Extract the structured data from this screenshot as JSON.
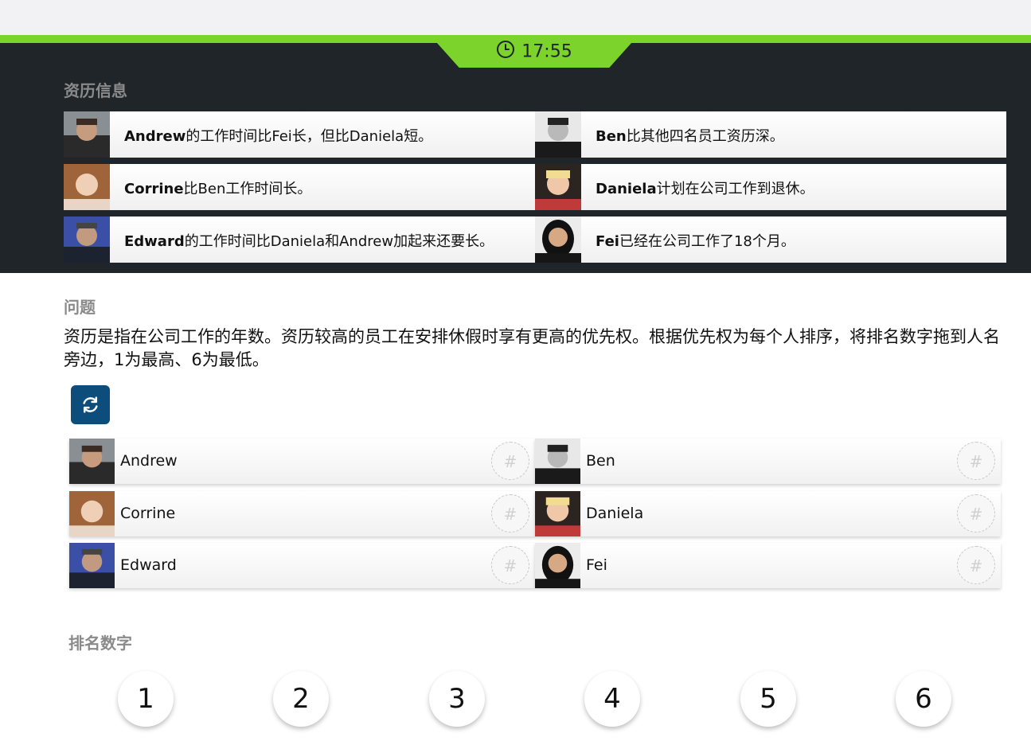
{
  "timer": {
    "time": "17:55"
  },
  "seniority": {
    "title": "资历信息",
    "facts": [
      {
        "name": "Andrew",
        "text": "的工作时间比Fei长，但比Daniela短。"
      },
      {
        "name": "Ben",
        "text": "比其他四名员工资历深。"
      },
      {
        "name": "Corrine",
        "text": "比Ben工作时间长。"
      },
      {
        "name": "Daniela",
        "text": "计划在公司工作到退休。"
      },
      {
        "name": "Edward",
        "text": "的工作时间比Daniela和Andrew加起来还要长。"
      },
      {
        "name": "Fei",
        "text": "已经在公司工作了18个月。"
      }
    ]
  },
  "question": {
    "title": "问题",
    "text": "资历是指在公司工作的年数。资历较高的员工在安排休假时享有更高的优先权。根据优先权为每个人排序，将排名数字拖到人名旁边，1为最高、6为最低。"
  },
  "people": [
    {
      "name": "Andrew",
      "slot": "#"
    },
    {
      "name": "Ben",
      "slot": "#"
    },
    {
      "name": "Corrine",
      "slot": "#"
    },
    {
      "name": "Daniela",
      "slot": "#"
    },
    {
      "name": "Edward",
      "slot": "#"
    },
    {
      "name": "Fei",
      "slot": "#"
    }
  ],
  "ranking": {
    "title": "排名数字",
    "numbers": [
      "1",
      "2",
      "3",
      "4",
      "5",
      "6"
    ]
  },
  "colors": {
    "accent": "#7bd32c",
    "dark": "#1f2529",
    "button": "#0d4d7c"
  },
  "icons": {
    "timer": "clock-icon",
    "refresh": "refresh-icon"
  }
}
